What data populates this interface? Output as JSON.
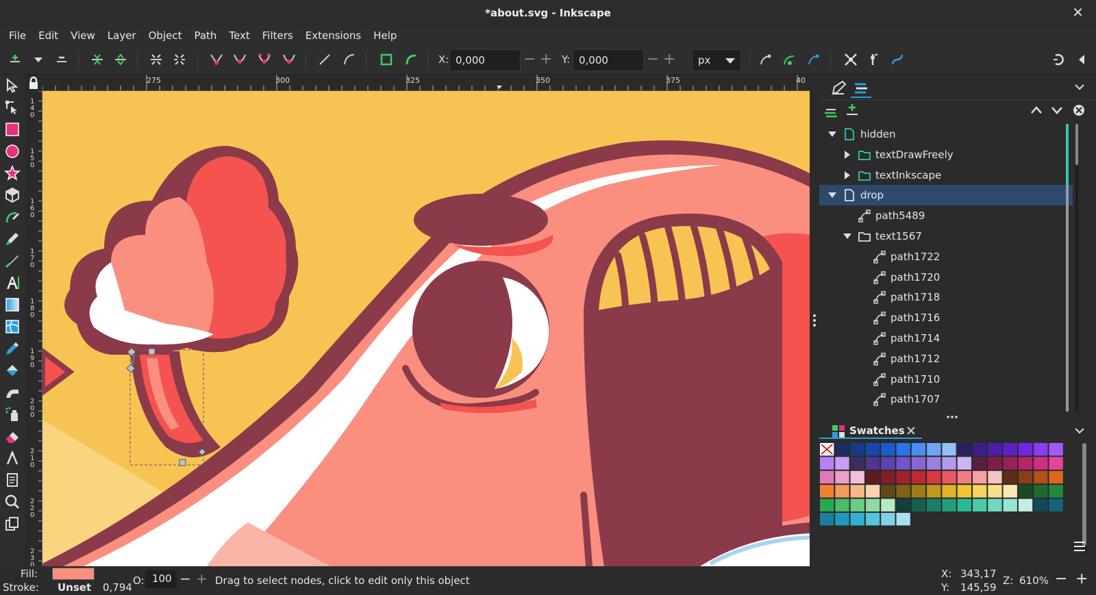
{
  "window": {
    "title": "*about.svg - Inkscape",
    "close_glyph": "✕"
  },
  "menu": [
    "File",
    "Edit",
    "View",
    "Layer",
    "Object",
    "Path",
    "Text",
    "Filters",
    "Extensions",
    "Help"
  ],
  "toolctrl": {
    "x_label": "X:",
    "x_value": "0,000",
    "y_label": "Y:",
    "y_value": "0,000",
    "unit": "px",
    "minus": "−",
    "plus": "+"
  },
  "ruler": {
    "h_labels": [
      "275",
      "300",
      "325",
      "350",
      "375",
      "40"
    ],
    "v_labels": [
      "1 4 0",
      "1 5 0",
      "1 6 0",
      "1 7 0",
      "1 8 0",
      "1 9 0",
      "2 0 0",
      "2 1 0",
      "2 2 0",
      "2 3 0"
    ]
  },
  "layers": [
    {
      "label": "hidden",
      "type": "layer",
      "expanded": true
    },
    {
      "label": "textDrawFreely",
      "type": "group",
      "expanded": false
    },
    {
      "label": "textInkscape",
      "type": "group",
      "expanded": false
    },
    {
      "label": "drop",
      "type": "layer",
      "expanded": true,
      "selected": true
    },
    {
      "label": "path5489",
      "type": "path"
    },
    {
      "label": "text1567",
      "type": "group",
      "expanded": true
    },
    {
      "label": "path1722",
      "type": "path"
    },
    {
      "label": "path1720",
      "type": "path"
    },
    {
      "label": "path1718",
      "type": "path"
    },
    {
      "label": "path1716",
      "type": "path"
    },
    {
      "label": "path1714",
      "type": "path"
    },
    {
      "label": "path1712",
      "type": "path"
    },
    {
      "label": "path1710",
      "type": "path"
    },
    {
      "label": "path1707",
      "type": "path"
    }
  ],
  "swatches": {
    "title": "Swatches",
    "colors": [
      "none",
      "#1c2e5e",
      "#173a8a",
      "#1747a8",
      "#1a5bd0",
      "#2a73e8",
      "#4a8ef0",
      "#6da6f4",
      "#92c0f8",
      "#2b1f5e",
      "#3a1f8a",
      "#4b1fa8",
      "#5d20c8",
      "#7226e0",
      "#8a3cee",
      "#a35af4",
      "#b880f2",
      "#c7a0f6",
      "#3a2d5e",
      "#4c3690",
      "#5e44ae",
      "#7056c6",
      "#8468d6",
      "#9a80e2",
      "#b29aec",
      "#cab6f4",
      "#5a1f3e",
      "#7c1e48",
      "#9c2058",
      "#b8246a",
      "#d02e80",
      "#e2489a",
      "#e27ab8",
      "#eaa0cc",
      "#f2c0dc",
      "#5e1a1f",
      "#7e1e26",
      "#a0222c",
      "#c02833",
      "#d83a40",
      "#e85a60",
      "#f27c80",
      "#f6a0a2",
      "#f8c2c4",
      "#5e2e14",
      "#8a3e16",
      "#b45018",
      "#e0661e",
      "#f08030",
      "#f49c5c",
      "#f8b888",
      "#fad2b2",
      "#5e4a14",
      "#7e6216",
      "#a07c18",
      "#c2981c",
      "#e0b422",
      "#f2c630",
      "#f6d45c",
      "#f9e088",
      "#faeab2",
      "#1a4a24",
      "#1e6a30",
      "#22883e",
      "#2aa84e",
      "#48bc68",
      "#6ccc86",
      "#92daa4",
      "#b8e8c4",
      "#12403a",
      "#16604e",
      "#1a8064",
      "#1ea07a",
      "#26bc92",
      "#48cca8",
      "#70dabe",
      "#98e6d2",
      "#c0f0e4",
      "#124a5a",
      "#16637a",
      "#1a7e9c",
      "#1e9abc",
      "#32b2d0",
      "#58c4dc",
      "#80d4e6",
      "#a8e2ee"
    ]
  },
  "status": {
    "fill_label": "Fill:",
    "stroke_label": "Stroke:",
    "stroke_value": "Unset",
    "stroke_width": "0,794",
    "fill_color": "#fa8f80",
    "opacity_label": "O:",
    "opacity_value": "100",
    "message": "Drag to select nodes, click to edit only this object",
    "x_label": "X:",
    "x_value": "343,17",
    "y_label": "Y:",
    "y_value": "145,59",
    "zoom_label": "Z:",
    "zoom_value": "610%"
  },
  "colors": {
    "canvas_bg": "#f7c453",
    "dark_outline": "#8a3a48",
    "body_pink": "#fa8f80",
    "red": "#f4534f",
    "white": "#ffffff",
    "selection_blue": "#2d4a6e",
    "accent_teal": "#2fc9b0"
  }
}
